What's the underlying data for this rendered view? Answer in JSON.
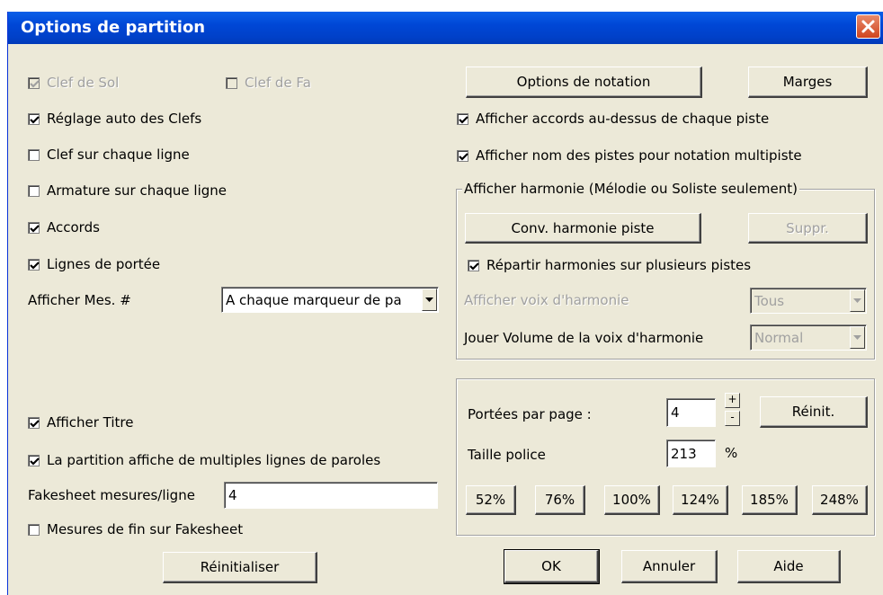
{
  "dialog": {
    "title": "Options de partition"
  },
  "left": {
    "clef_sol": {
      "label": "Clef de Sol",
      "checked": true,
      "enabled": false
    },
    "clef_fa": {
      "label": "Clef de Fa",
      "checked": false,
      "enabled": false
    },
    "reglage_auto": {
      "label": "Réglage auto des Clefs",
      "checked": true
    },
    "clef_ligne": {
      "label": "Clef sur chaque ligne",
      "checked": false
    },
    "armature_ligne": {
      "label": "Armature sur chaque ligne",
      "checked": false
    },
    "accords": {
      "label": "Accords",
      "checked": true
    },
    "lignes_portee": {
      "label": "Lignes de portée",
      "checked": true
    },
    "afficher_mes_label": "Afficher Mes. #",
    "afficher_mes_value": "A chaque marqueur de pa",
    "afficher_titre": {
      "label": "Afficher Titre",
      "checked": true
    },
    "multiples_paroles": {
      "label": "La partition affiche de multiples lignes de paroles",
      "checked": true
    },
    "fakesheet_label": "Fakesheet mesures/ligne",
    "fakesheet_value": "4",
    "mesures_fin": {
      "label": "Mesures de fin sur Fakesheet",
      "checked": false
    },
    "reinitialiser_label": "Réinitialiser"
  },
  "right": {
    "options_notation_label": "Options de notation",
    "marges_label": "Marges",
    "afficher_accords": {
      "label": "Afficher accords au-dessus de chaque piste",
      "checked": true
    },
    "afficher_nom_pistes": {
      "label": "Afficher nom des pistes pour notation multipiste",
      "checked": true
    },
    "harmonie": {
      "title": "Afficher harmonie (Mélodie ou Soliste seulement)",
      "conv_label": "Conv. harmonie piste",
      "suppr_label": "Suppr.",
      "repartir": {
        "label": "Répartir harmonies sur plusieurs pistes",
        "checked": true
      },
      "voix_label": "Afficher voix d'harmonie",
      "voix_value": "Tous",
      "volume_label": "Jouer Volume de la voix d'harmonie",
      "volume_value": "Normal"
    },
    "page": {
      "portees_label": "Portées par page :",
      "portees_value": "4",
      "plus": "+",
      "minus": "-",
      "reinit_label": "Réinit.",
      "taille_label": "Taille police",
      "taille_value": "213",
      "percent_sign": "%",
      "zoom_buttons": [
        "52%",
        "76%",
        "100%",
        "124%",
        "185%",
        "248%"
      ]
    },
    "ok_label": "OK",
    "annuler_label": "Annuler",
    "aide_label": "Aide"
  }
}
